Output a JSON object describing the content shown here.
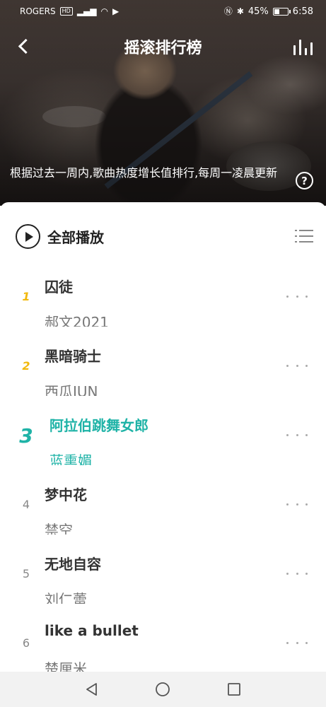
{
  "status_bar": {
    "carrier": "ROGERS",
    "carrier_badge": "HD",
    "battery_percent": "45%",
    "battery_level": 0.45,
    "time": "6:58"
  },
  "header": {
    "title": "摇滚排行榜",
    "description": "根据过去一周内,歌曲热度增长值排行,每周一凌晨更新",
    "help_glyph": "?"
  },
  "controls": {
    "play_all_label": "全部播放"
  },
  "songs": [
    {
      "rank": "1",
      "title": "囚徒",
      "artist": "郝文2021"
    },
    {
      "rank": "2",
      "title": "黑暗骑士",
      "artist": "西瓜JUN"
    },
    {
      "rank": "3",
      "title": "阿拉伯跳舞女郎",
      "artist": "蓝熏媚"
    },
    {
      "rank": "4",
      "title": "梦中花",
      "artist": "禁空"
    },
    {
      "rank": "5",
      "title": "无地自容",
      "artist": "刘仁蕾"
    },
    {
      "rank": "6",
      "title": "like a bullet",
      "artist": "楚厘米"
    }
  ],
  "colors": {
    "accent": "#1fb3a7",
    "gold": "#f2b90e"
  },
  "icons": [
    "back-icon",
    "equalizer-icon",
    "help-icon",
    "play-icon",
    "list-icon",
    "more-icon",
    "nav-back-icon",
    "nav-home-icon",
    "nav-recent-icon"
  ]
}
